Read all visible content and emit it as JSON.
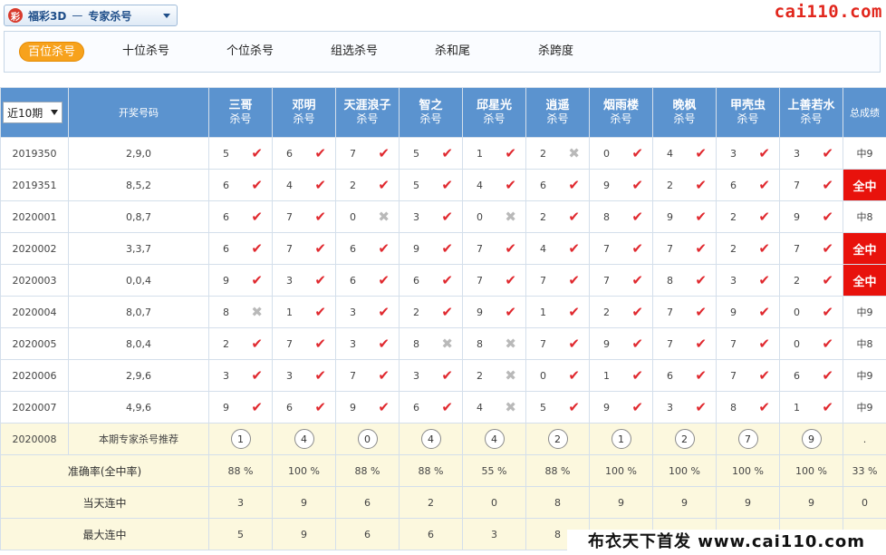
{
  "header": {
    "lottery_name": "福彩3D",
    "separator": "—",
    "page_name": "专家杀号",
    "logo_glyph": "彩",
    "site_logo": "cai110.com"
  },
  "tabs": [
    {
      "label": "百位杀号",
      "active": true
    },
    {
      "label": "十位杀号",
      "active": false
    },
    {
      "label": "个位杀号",
      "active": false
    },
    {
      "label": "组选杀号",
      "active": false
    },
    {
      "label": "杀和尾",
      "active": false
    },
    {
      "label": "杀跨度",
      "active": false
    }
  ],
  "table": {
    "period_select": "近10期",
    "draw_header": "开奖号码",
    "total_header": "总成绩",
    "expert_sub": "杀号",
    "experts": [
      "三哥",
      "邓明",
      "天涯浪子",
      "智之",
      "邱星光",
      "逍遥",
      "烟雨楼",
      "晚枫",
      "甲壳虫",
      "上善若水"
    ],
    "rows": [
      {
        "period": "2019350",
        "draw": "2,9,0",
        "picks": [
          5,
          6,
          7,
          5,
          1,
          2,
          0,
          4,
          3,
          3
        ],
        "hits": [
          1,
          1,
          1,
          1,
          1,
          0,
          1,
          1,
          1,
          1
        ],
        "total": "中9",
        "full": false
      },
      {
        "period": "2019351",
        "draw": "8,5,2",
        "picks": [
          6,
          4,
          2,
          5,
          4,
          6,
          9,
          2,
          6,
          7
        ],
        "hits": [
          1,
          1,
          1,
          1,
          1,
          1,
          1,
          1,
          1,
          1
        ],
        "total": "全中",
        "full": true
      },
      {
        "period": "2020001",
        "draw": "0,8,7",
        "picks": [
          6,
          7,
          0,
          3,
          0,
          2,
          8,
          9,
          2,
          9
        ],
        "hits": [
          1,
          1,
          0,
          1,
          0,
          1,
          1,
          1,
          1,
          1
        ],
        "total": "中8",
        "full": false
      },
      {
        "period": "2020002",
        "draw": "3,3,7",
        "picks": [
          6,
          7,
          6,
          9,
          7,
          4,
          7,
          7,
          2,
          7
        ],
        "hits": [
          1,
          1,
          1,
          1,
          1,
          1,
          1,
          1,
          1,
          1
        ],
        "total": "全中",
        "full": true
      },
      {
        "period": "2020003",
        "draw": "0,0,4",
        "picks": [
          9,
          3,
          6,
          6,
          7,
          7,
          7,
          8,
          3,
          2
        ],
        "hits": [
          1,
          1,
          1,
          1,
          1,
          1,
          1,
          1,
          1,
          1
        ],
        "total": "全中",
        "full": true
      },
      {
        "period": "2020004",
        "draw": "8,0,7",
        "picks": [
          8,
          1,
          3,
          2,
          9,
          1,
          2,
          7,
          9,
          0
        ],
        "hits": [
          0,
          1,
          1,
          1,
          1,
          1,
          1,
          1,
          1,
          1
        ],
        "total": "中9",
        "full": false
      },
      {
        "period": "2020005",
        "draw": "8,0,4",
        "picks": [
          2,
          7,
          3,
          8,
          8,
          7,
          9,
          7,
          7,
          0
        ],
        "hits": [
          1,
          1,
          1,
          0,
          0,
          1,
          1,
          1,
          1,
          1
        ],
        "total": "中8",
        "full": false
      },
      {
        "period": "2020006",
        "draw": "2,9,6",
        "picks": [
          3,
          3,
          7,
          3,
          2,
          0,
          1,
          6,
          7,
          6
        ],
        "hits": [
          1,
          1,
          1,
          1,
          0,
          1,
          1,
          1,
          1,
          1
        ],
        "total": "中9",
        "full": false
      },
      {
        "period": "2020007",
        "draw": "4,9,6",
        "picks": [
          9,
          6,
          9,
          6,
          4,
          5,
          9,
          3,
          8,
          1
        ],
        "hits": [
          1,
          1,
          1,
          1,
          0,
          1,
          1,
          1,
          1,
          1
        ],
        "total": "中9",
        "full": false
      }
    ],
    "recommend": {
      "period": "2020008",
      "label": "本期专家杀号推荐",
      "balls": [
        1,
        4,
        0,
        4,
        4,
        2,
        1,
        2,
        7,
        9
      ],
      "total": "."
    },
    "stats": [
      {
        "label": "准确率(全中率)",
        "values": [
          "88 %",
          "100 %",
          "88 %",
          "88 %",
          "55 %",
          "88 %",
          "100 %",
          "100 %",
          "100 %",
          "100 %"
        ],
        "total": "33 %"
      },
      {
        "label": "当天连中",
        "values": [
          "3",
          "9",
          "6",
          "2",
          "0",
          "8",
          "9",
          "9",
          "9",
          "9"
        ],
        "total": "0"
      },
      {
        "label": "最大连中",
        "values": [
          "5",
          "9",
          "6",
          "6",
          "3",
          "8",
          "",
          "",
          "",
          ""
        ],
        "total": ""
      }
    ]
  },
  "footer": {
    "watermark": "布衣天下首发 www.cai110.com"
  }
}
